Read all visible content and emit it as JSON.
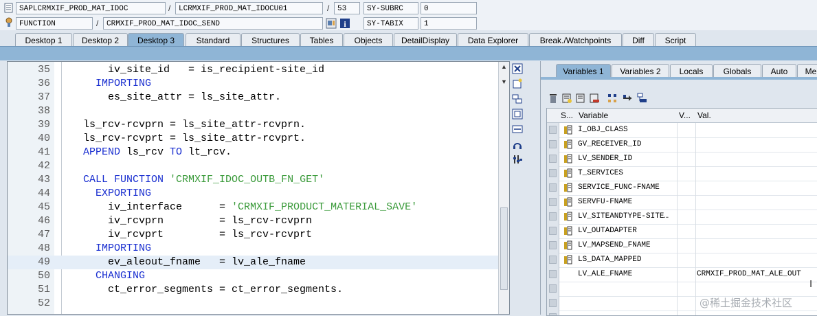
{
  "debug_header": {
    "program": "SAPLCRMXIF_PROD_MAT_IDOC",
    "include": "LCRMXIF_PROD_MAT_IDOCU01",
    "line": "53",
    "sysfield1_name": "SY-SUBRC",
    "sysfield1_value": "0",
    "event_type": "FUNCTION",
    "event_name": "CRMXIF_PROD_MAT_IDOC_SEND",
    "sysfield2_name": "SY-TABIX",
    "sysfield2_value": "1",
    "separator": "/"
  },
  "tabs": [
    "Desktop 1",
    "Desktop 2",
    "Desktop 3",
    "Standard",
    "Structures",
    "Tables",
    "Objects",
    "DetailDisplay",
    "Data Explorer",
    "Break./Watchpoints",
    "Diff",
    "Script"
  ],
  "active_tab": "Desktop 3",
  "code_lines": [
    {
      "num": "35",
      "parts": [
        {
          "t": "      iv_site_id   = is_recipient-site_id",
          "c": ""
        }
      ]
    },
    {
      "num": "36",
      "parts": [
        {
          "t": "    IMPORTING",
          "c": "kw"
        }
      ]
    },
    {
      "num": "37",
      "parts": [
        {
          "t": "      es_site_attr = ls_site_attr.",
          "c": ""
        }
      ]
    },
    {
      "num": "38",
      "parts": [
        {
          "t": "",
          "c": ""
        }
      ]
    },
    {
      "num": "39",
      "parts": [
        {
          "t": "  ls_rcv-rcvprn = ls_site_attr-rcvprn.",
          "c": ""
        }
      ]
    },
    {
      "num": "40",
      "parts": [
        {
          "t": "  ls_rcv-rcvprt = ls_site_attr-rcvprt.",
          "c": ""
        }
      ]
    },
    {
      "num": "41",
      "parts": [
        {
          "t": "  APPEND",
          "c": "kw"
        },
        {
          "t": " ls_rcv ",
          "c": ""
        },
        {
          "t": "TO",
          "c": "kw"
        },
        {
          "t": " lt_rcv.",
          "c": ""
        }
      ]
    },
    {
      "num": "42",
      "parts": [
        {
          "t": "",
          "c": ""
        }
      ]
    },
    {
      "num": "43",
      "parts": [
        {
          "t": "  CALL FUNCTION",
          "c": "kw"
        },
        {
          "t": " ",
          "c": ""
        },
        {
          "t": "'CRMXIF_IDOC_OUTB_FN_GET'",
          "c": "str"
        }
      ]
    },
    {
      "num": "44",
      "parts": [
        {
          "t": "    EXPORTING",
          "c": "kw"
        }
      ]
    },
    {
      "num": "45",
      "parts": [
        {
          "t": "      iv_interface      = ",
          "c": ""
        },
        {
          "t": "'CRMXIF_PRODUCT_MATERIAL_SAVE'",
          "c": "str"
        }
      ]
    },
    {
      "num": "46",
      "parts": [
        {
          "t": "      iv_rcvprn         = ls_rcv-rcvprn",
          "c": ""
        }
      ]
    },
    {
      "num": "47",
      "parts": [
        {
          "t": "      iv_rcvprt         = ls_rcv-rcvprt",
          "c": ""
        }
      ]
    },
    {
      "num": "48",
      "parts": [
        {
          "t": "    IMPORTING",
          "c": "kw"
        }
      ]
    },
    {
      "num": "49",
      "parts": [
        {
          "t": "      ev_aleout_fname   = lv_ale_fname",
          "c": ""
        }
      ],
      "highlight": true
    },
    {
      "num": "50",
      "parts": [
        {
          "t": "    CHANGING",
          "c": "kw"
        }
      ]
    },
    {
      "num": "51",
      "parts": [
        {
          "t": "      ct_error_segments = ct_error_segments.",
          "c": ""
        }
      ]
    },
    {
      "num": "52",
      "parts": [
        {
          "t": "",
          "c": ""
        }
      ]
    }
  ],
  "right_tabs": [
    "Variables 1",
    "Variables 2",
    "Locals",
    "Globals",
    "Auto",
    "Me"
  ],
  "right_active_tab": "Variables 1",
  "var_table": {
    "headers": [
      "S...",
      "Variable",
      "V...",
      "Val."
    ],
    "rows": [
      {
        "name": "I_OBJ_CLASS",
        "value": "",
        "icon": true
      },
      {
        "name": "GV_RECEIVER_ID",
        "value": "",
        "icon": true
      },
      {
        "name": "LV_SENDER_ID",
        "value": "",
        "icon": true
      },
      {
        "name": "T_SERVICES",
        "value": "",
        "icon": true
      },
      {
        "name": "SERVICE_FUNC-FNAME",
        "value": "",
        "icon": true
      },
      {
        "name": "SERVFU-FNAME",
        "value": "",
        "icon": true
      },
      {
        "name": "LV_SITEANDTYPE-SITE…",
        "value": "",
        "icon": true
      },
      {
        "name": "LV_OUTADAPTER",
        "value": "",
        "icon": true
      },
      {
        "name": "LV_MAPSEND_FNAME",
        "value": "",
        "icon": true
      },
      {
        "name": "LS_DATA_MAPPED",
        "value": "",
        "icon": true
      },
      {
        "name": "LV_ALE_FNAME",
        "value": "CRMXIF_PROD_MAT_ALE_OUT",
        "icon": false
      },
      {
        "name": "",
        "value": "",
        "icon": false
      },
      {
        "name": "",
        "value": "",
        "icon": false
      },
      {
        "name": "",
        "value": "",
        "icon": false
      }
    ]
  },
  "watermark": "@稀土掘金技术社区",
  "colors": {
    "accent": "#8fb5d6",
    "keyword": "#1a2fd0",
    "string": "#3a9a3a"
  }
}
